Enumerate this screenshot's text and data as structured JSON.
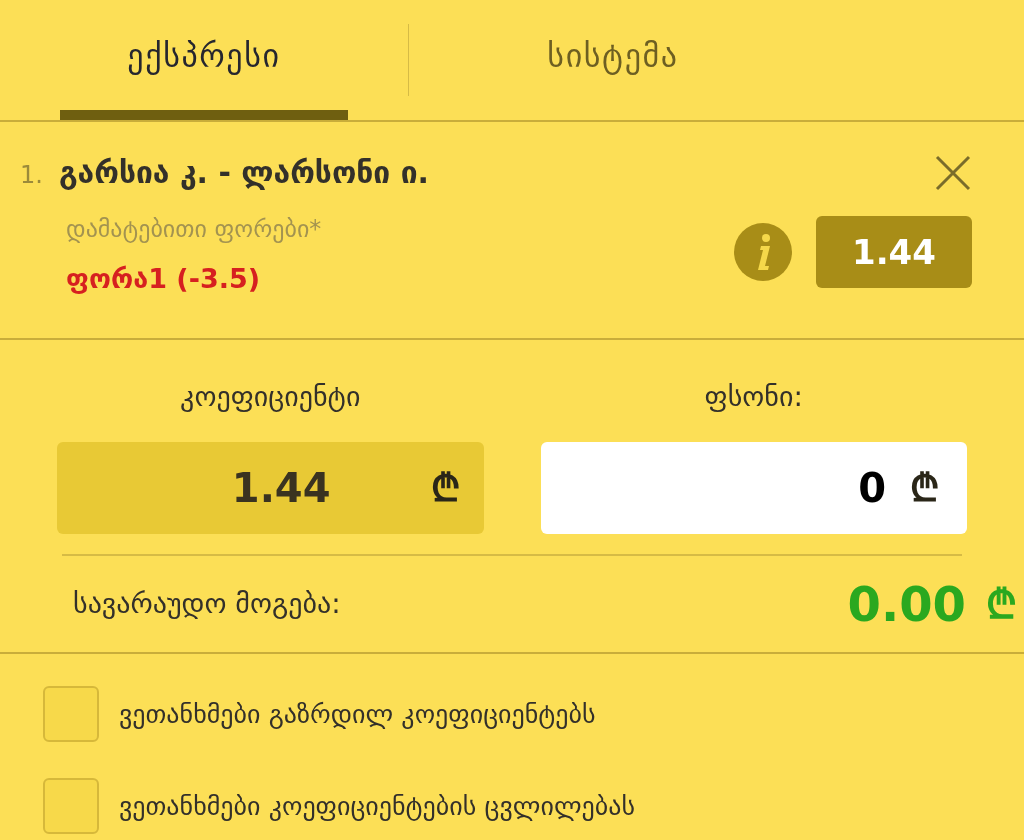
{
  "tabs": [
    {
      "label": "ექსპრესი",
      "selected": true
    },
    {
      "label": "სისტემა",
      "selected": false
    }
  ],
  "bet": {
    "number": "1.",
    "event": "გარსია კ. - ლარსონი ი.",
    "market": "დამატებითი ფორები*",
    "selection": "ფორა1 (-3.5)",
    "odds": "1.44"
  },
  "coefficient": {
    "label": "კოეფიციენტი",
    "value": "1.44",
    "currency": "₾"
  },
  "stake": {
    "label": "ფსონი:",
    "value": "0",
    "currency": "₾"
  },
  "potential_win": {
    "label": "სავარაუდო მოგება:",
    "value": "0.00",
    "currency": "₾"
  },
  "options": [
    {
      "label": "ვეთანხმები გაზრდილ კოეფიციენტებს",
      "checked": false
    },
    {
      "label": "ვეთანხმები კოეფიციენტების ცვლილებას",
      "checked": false
    }
  ]
}
